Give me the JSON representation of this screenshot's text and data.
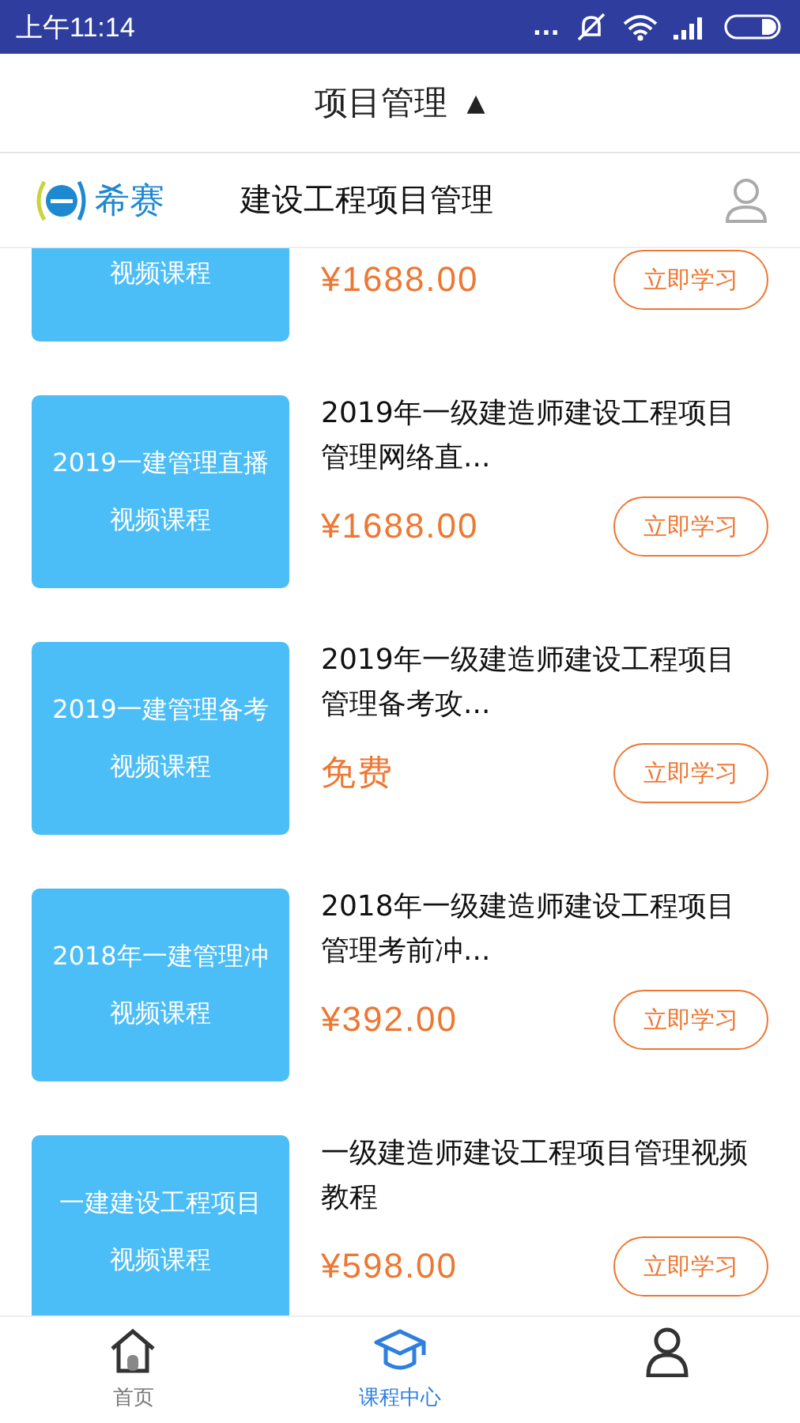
{
  "status_bar": {
    "time": "上午11:14",
    "more": "..."
  },
  "header": {
    "title": "项目管理",
    "toggle": "▲"
  },
  "brand_bar": {
    "logo_text": "希赛",
    "title": "建设工程项目管理"
  },
  "courses": [
    {
      "card_subtitle": "视频课程",
      "price": "¥1688.00",
      "button": "立即学习"
    },
    {
      "card_title": "2019一建管理直播",
      "card_subtitle": "视频课程",
      "title": "2019年一级建造师建设工程项目管理网络直...",
      "price": "¥1688.00",
      "button": "立即学习"
    },
    {
      "card_title": "2019一建管理备考",
      "card_subtitle": "视频课程",
      "title": "2019年一级建造师建设工程项目管理备考攻...",
      "price": "免费",
      "button": "立即学习"
    },
    {
      "card_title": "2018年一建管理冲",
      "card_subtitle": "视频课程",
      "title": "2018年一级建造师建设工程项目管理考前冲...",
      "price": "¥392.00",
      "button": "立即学习"
    },
    {
      "card_title": "一建建设工程项目",
      "card_subtitle": "视频课程",
      "title": "一级建造师建设工程项目管理视频教程",
      "price": "¥598.00",
      "button": "立即学习"
    }
  ],
  "tabs": [
    {
      "kind": "home",
      "label": "首页",
      "selected": false
    },
    {
      "kind": "course",
      "label": "课程中心",
      "selected": true
    },
    {
      "kind": "profile",
      "selected": false
    }
  ]
}
